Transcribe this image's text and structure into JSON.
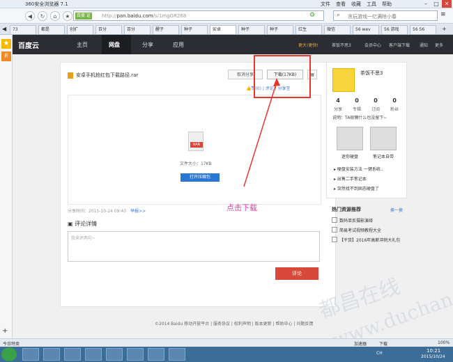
{
  "browser": {
    "title": "360安全浏览器 7.1",
    "menu": [
      "文件",
      "查看",
      "收藏",
      "工具",
      "帮助"
    ],
    "cert_label": "百度 证",
    "url_host": "pan.baidu.com",
    "url_path": "/s/1mgGR268",
    "url_prefix": "http://",
    "search_placeholder": "贪玩游戏一亿满除小春",
    "tabs": [
      "73",
      "都是",
      "创扩",
      "百分",
      "百分",
      "醒子",
      "种子",
      "安卓",
      "种子",
      "种子",
      "红生",
      "微信",
      "56 wev",
      "56 游戏",
      "56 56"
    ],
    "active_tab_index": 7
  },
  "sidebar": {
    "star": "★",
    "item2": "折",
    "plus": "+"
  },
  "baidu_nav": {
    "logo": "百度云",
    "links": [
      "主页",
      "网盘",
      "分享",
      "应用"
    ],
    "active": "网盘",
    "right_items": [
      "更大!更快!",
      "茶饭不思3",
      "会员中心",
      "客户端下载",
      "通知",
      "更多"
    ]
  },
  "file": {
    "name": "安卓手机抢红包下载路径.rar",
    "cancel_share": "取消分享",
    "download": "下载(17KB)",
    "actions": "👍赞(0) | 评论 | 分享至",
    "rar_label": "RAR",
    "size_text": "文件大小：17KB",
    "open_btn": "打开压缩包",
    "share_time": "分享时间：2015-10-24 09:40",
    "report": "举报>>"
  },
  "comments": {
    "title": "评论详情",
    "placeholder": "我来评两句~",
    "submit": "评论"
  },
  "profile": {
    "username": "茶饭不思3",
    "stats": [
      {
        "num": "4",
        "label": "分享"
      },
      {
        "num": "0",
        "label": "专辑"
      },
      {
        "num": "0",
        "label": "订阅"
      },
      {
        "num": "0",
        "label": "粉丝"
      }
    ],
    "desc": "说明：TA很懒什么也没留下~",
    "thumbs": [
      "迷你硬盘",
      "笔记本自带"
    ],
    "list": [
      "硬盘安装方法 一键系统..",
      "出售二手笔记本",
      "突然找不到固态硬盘了"
    ]
  },
  "hot": {
    "title": "热门资源推荐",
    "switch": "换一换",
    "items": [
      "数码单反摄影演绎",
      "简易考试视频教程大全",
      "【干货】2016年高薪冲刺大礼包"
    ]
  },
  "annotation": {
    "note": "点击下载"
  },
  "footer": "©2014 Baidu 移动开放平台 | 服务协议 | 权利声明 | 版本更新 | 帮助中心 | 问题反馈",
  "watermark": {
    "cn": "都昌在线",
    "en": "www.duchang.org"
  },
  "statusbar": {
    "left": "今日特卖",
    "items": [
      "加速器",
      "下载",
      "100%"
    ]
  },
  "taskbar": {
    "tray": "CH",
    "time": "10:21",
    "date": "2015/10/24"
  }
}
